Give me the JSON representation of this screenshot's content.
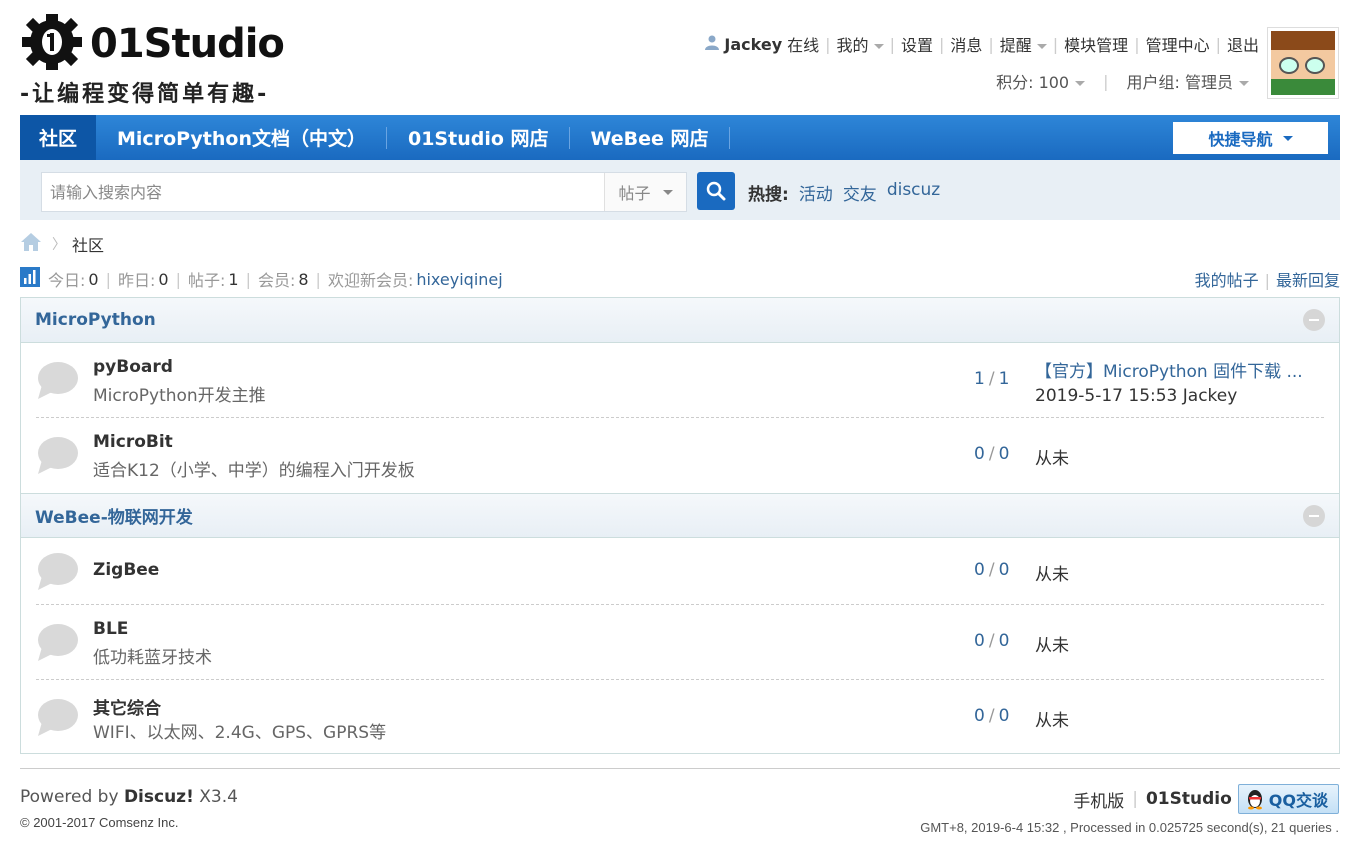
{
  "logo": {
    "brand": "01Studio",
    "slogan": "-让编程变得简单有趣-"
  },
  "user_bar": {
    "username": "Jackey",
    "status": "在线",
    "links": [
      "我的",
      "设置",
      "消息",
      "提醒",
      "模块管理",
      "管理中心",
      "退出"
    ]
  },
  "user_info": {
    "credits": "积分: 100",
    "group": "用户组: 管理员"
  },
  "nav": {
    "items": [
      "社区",
      "MicroPython文档（中文）",
      "01Studio 网店",
      "WeBee 网店"
    ],
    "quicknav": "快捷导航"
  },
  "search": {
    "placeholder": "请输入搜索内容",
    "type": "帖子",
    "hot_label": "热搜:",
    "hot_terms": [
      "活动",
      "交友",
      "discuz"
    ]
  },
  "breadcrumb": {
    "current": "社区"
  },
  "stats": {
    "today_label": "今日:",
    "today": "0",
    "yesterday_label": "昨日:",
    "yesterday": "0",
    "posts_label": "帖子:",
    "posts": "1",
    "members_label": "会员:",
    "members": "8",
    "welcome_label": "欢迎新会员:",
    "new_member": "hixeyiqinej",
    "my_posts": "我的帖子",
    "latest_replies": "最新回复"
  },
  "categories": [
    {
      "title": "MicroPython",
      "forums": [
        {
          "name": "pyBoard",
          "desc": "MicroPython开发主推",
          "threads": "1",
          "posts": "1",
          "last_title": "【官方】MicroPython 固件下载 ...",
          "last_meta": "2019-5-17 15:53 Jackey"
        },
        {
          "name": "MicroBit",
          "desc": "适合K12（小学、中学）的编程入门开发板",
          "threads": "0",
          "posts": "0",
          "never": "从未"
        }
      ]
    },
    {
      "title": "WeBee-物联网开发",
      "forums": [
        {
          "name": "ZigBee",
          "desc": "",
          "threads": "0",
          "posts": "0",
          "never": "从未"
        },
        {
          "name": "BLE",
          "desc": "低功耗蓝牙技术",
          "threads": "0",
          "posts": "0",
          "never": "从未"
        },
        {
          "name": "其它综合",
          "desc": "WIFI、以太网、2.4G、GPS、GPRS等",
          "threads": "0",
          "posts": "0",
          "never": "从未"
        }
      ]
    }
  ],
  "footer": {
    "powered_prefix": "Powered by",
    "powered_product": "Discuz!",
    "powered_version": "X3.4",
    "copyright": "© 2001-2017 Comsenz Inc.",
    "mobile": "手机版",
    "site": "01Studio",
    "qq": "QQ交谈",
    "gmt": "GMT+8, 2019-6-4 15:32 , Processed in 0.025725 second(s), 21 queries ."
  }
}
